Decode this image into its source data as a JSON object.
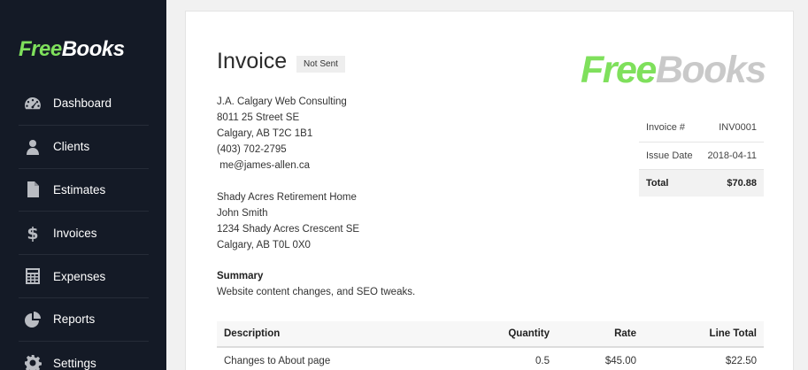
{
  "sidebar": {
    "logo": {
      "free": "Free",
      "books": "Books"
    },
    "items": [
      {
        "label": "Dashboard",
        "icon": "dashboard-icon"
      },
      {
        "label": "Clients",
        "icon": "user-icon"
      },
      {
        "label": "Estimates",
        "icon": "document-icon"
      },
      {
        "label": "Invoices",
        "icon": "dollar-icon"
      },
      {
        "label": "Expenses",
        "icon": "calculator-icon"
      },
      {
        "label": "Reports",
        "icon": "pie-chart-icon"
      },
      {
        "label": "Settings",
        "icon": "gear-icon"
      }
    ]
  },
  "invoice": {
    "title": "Invoice",
    "status": "Not Sent",
    "logo": {
      "free": "Free",
      "books": "Books"
    },
    "from": [
      "J.A. Calgary Web Consulting",
      "8011 25 Street SE",
      "Calgary, AB T2C 1B1",
      "(403) 702-2795",
      " me@james-allen.ca"
    ],
    "to": [
      "Shady Acres Retirement Home",
      "John Smith",
      "1234 Shady Acres Crescent SE",
      "Calgary, AB T0L 0X0"
    ],
    "summary_heading": "Summary",
    "summary_text": "Website content changes, and SEO tweaks.",
    "meta": {
      "number_label": "Invoice #",
      "number": "INV0001",
      "date_label": "Issue Date",
      "date": "2018-04-11",
      "total_label": "Total",
      "total": "$70.88"
    },
    "items_header": {
      "description": "Description",
      "quantity": "Quantity",
      "rate": "Rate",
      "line_total": "Line Total"
    },
    "items": [
      {
        "description": "Changes to About page",
        "quantity": "0.5",
        "rate": "$45.00",
        "line_total": "$22.50"
      }
    ]
  },
  "colors": {
    "sidebar_bg": "#141a26",
    "brand_green": "#7fe05c",
    "logo_grey": "#c9c9c9"
  }
}
